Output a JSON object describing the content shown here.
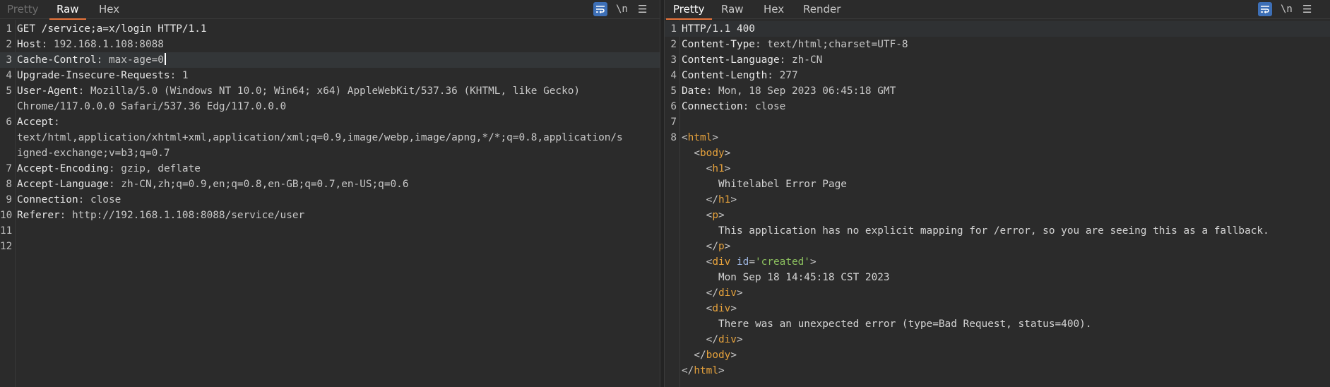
{
  "request": {
    "tabs": [
      "Pretty",
      "Raw",
      "Hex"
    ],
    "active_tab": "Raw",
    "tools": {
      "newline_label": "\\n",
      "menu_glyph": "☰"
    },
    "lines": [
      {
        "n": "1",
        "name": "GET /service;a=x/login HTTP/1.1",
        "value": ""
      },
      {
        "n": "2",
        "name": "Host",
        "value": ": 192.168.1.108:8088"
      },
      {
        "n": "3",
        "name": "Cache-Control",
        "value": ": max-age=0"
      },
      {
        "n": "4",
        "name": "Upgrade-Insecure-Requests",
        "value": ": 1"
      },
      {
        "n": "5",
        "name": "User-Agent",
        "value": ": Mozilla/5.0 (Windows NT 10.0; Win64; x64) AppleWebKit/537.36 (KHTML, like Gecko)"
      },
      {
        "n": "",
        "name": "",
        "value": "Chrome/117.0.0.0 Safari/537.36 Edg/117.0.0.0"
      },
      {
        "n": "6",
        "name": "Accept",
        "value": ":"
      },
      {
        "n": "",
        "name": "",
        "value": "text/html,application/xhtml+xml,application/xml;q=0.9,image/webp,image/apng,*/*;q=0.8,application/s"
      },
      {
        "n": "",
        "name": "",
        "value": "igned-exchange;v=b3;q=0.7"
      },
      {
        "n": "7",
        "name": "Accept-Encoding",
        "value": ": gzip, deflate"
      },
      {
        "n": "8",
        "name": "Accept-Language",
        "value": ": zh-CN,zh;q=0.9,en;q=0.8,en-GB;q=0.7,en-US;q=0.6"
      },
      {
        "n": "9",
        "name": "Connection",
        "value": ": close"
      },
      {
        "n": "10",
        "name": "Referer",
        "value": ": http://192.168.1.108:8088/service/user"
      },
      {
        "n": "11",
        "name": "",
        "value": ""
      },
      {
        "n": "12",
        "name": "",
        "value": ""
      }
    ]
  },
  "response": {
    "tabs": [
      "Pretty",
      "Raw",
      "Hex",
      "Render"
    ],
    "active_tab": "Pretty",
    "tools": {
      "newline_label": "\\n",
      "menu_glyph": "☰"
    },
    "header_lines": [
      {
        "n": "1",
        "name": "HTTP/1.1 400",
        "value": ""
      },
      {
        "n": "2",
        "name": "Content-Type",
        "value": ": text/html;charset=UTF-8"
      },
      {
        "n": "3",
        "name": "Content-Language",
        "value": ": zh-CN"
      },
      {
        "n": "4",
        "name": "Content-Length",
        "value": ": 277"
      },
      {
        "n": "5",
        "name": "Date",
        "value": ": Mon, 18 Sep 2023 06:45:18 GMT"
      },
      {
        "n": "6",
        "name": "Connection",
        "value": ": close"
      },
      {
        "n": "7",
        "name": "",
        "value": ""
      }
    ],
    "body_lines": [
      {
        "n": "8",
        "pre": "",
        "tag": "html",
        "close": false
      },
      {
        "n": "",
        "pre": "  ",
        "tag": "body",
        "close": false
      },
      {
        "n": "",
        "pre": "    ",
        "tag": "h1",
        "close": false
      },
      {
        "n": "",
        "pre": "      ",
        "text": "Whitelabel Error Page"
      },
      {
        "n": "",
        "pre": "    ",
        "tag": "h1",
        "close": true
      },
      {
        "n": "",
        "pre": "    ",
        "tag": "p",
        "close": false
      },
      {
        "n": "",
        "pre": "      ",
        "text": "This application has no explicit mapping for /error, so you are seeing this as a fallback."
      },
      {
        "n": "",
        "pre": "    ",
        "tag": "p",
        "close": true
      },
      {
        "n": "",
        "pre": "    ",
        "tag": "div",
        "close": false,
        "attr_name": "id",
        "attr_value": "'created'"
      },
      {
        "n": "",
        "pre": "      ",
        "text": "Mon Sep 18 14:45:18 CST 2023"
      },
      {
        "n": "",
        "pre": "    ",
        "tag": "div",
        "close": true
      },
      {
        "n": "",
        "pre": "    ",
        "tag": "div",
        "close": false
      },
      {
        "n": "",
        "pre": "      ",
        "text": "There was an unexpected error (type=Bad Request, status=400)."
      },
      {
        "n": "",
        "pre": "    ",
        "tag": "div",
        "close": true
      },
      {
        "n": "",
        "pre": "  ",
        "tag": "body",
        "close": true
      },
      {
        "n": "",
        "pre": "",
        "tag": "html",
        "close": true
      }
    ]
  },
  "colors": {
    "accent": "#e8743b",
    "wrap_button": "#3d6fb6",
    "tag": "#e6a23c",
    "attr_value": "#8bbf5e"
  }
}
